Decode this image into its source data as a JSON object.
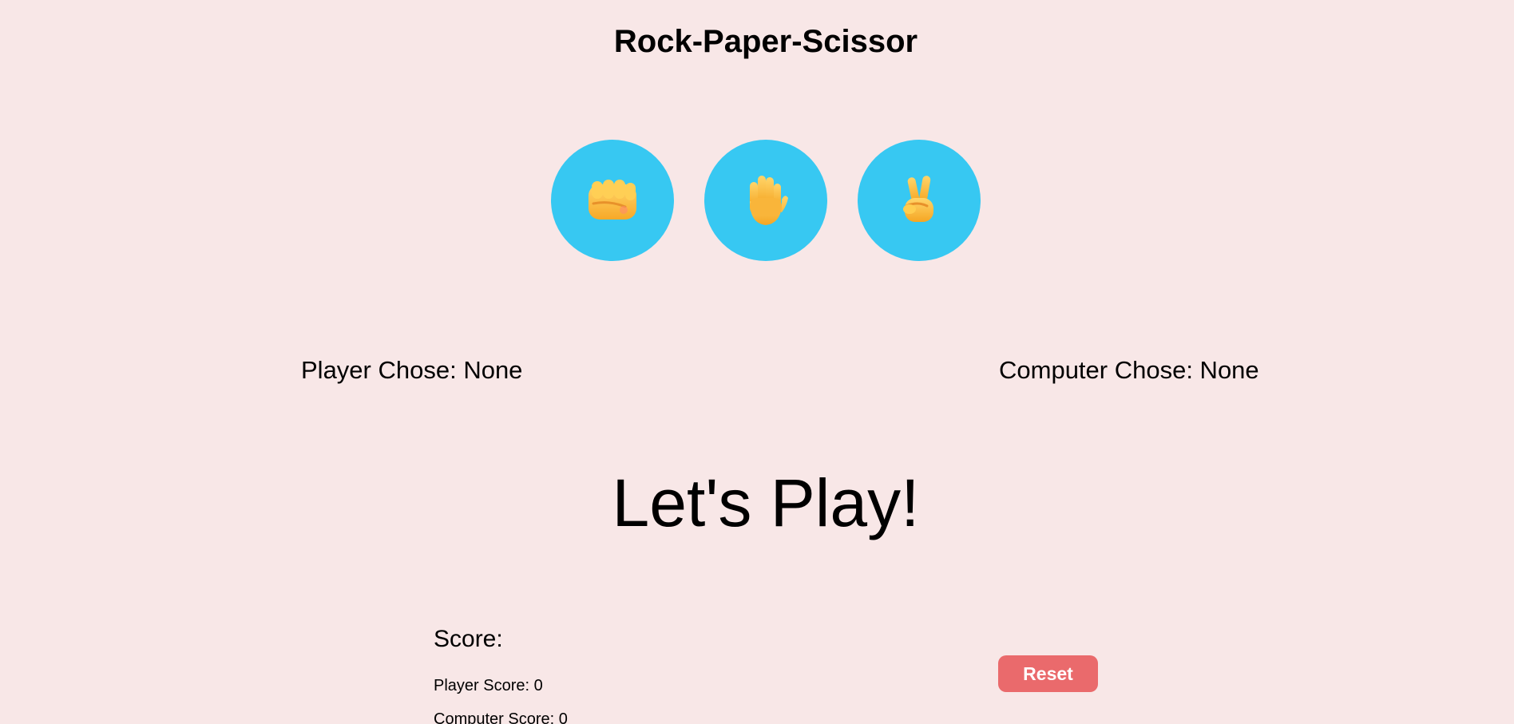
{
  "title": "Rock-Paper-Scissor",
  "choices": [
    {
      "label": "Rock",
      "icon": "fist-icon"
    },
    {
      "label": "Paper",
      "icon": "raised-hand-icon"
    },
    {
      "label": "Scissor",
      "icon": "victory-hand-icon"
    }
  ],
  "player_chose": "Player Chose: None",
  "computer_chose": "Computer Chose: None",
  "status": "Let's Play!",
  "score": {
    "title": "Score:",
    "player": "Player Score: 0",
    "computer": "Computer Score: 0"
  },
  "reset_label": "Reset",
  "colors": {
    "background": "#f8e7e7",
    "choice_button": "#37c8f2",
    "reset_button": "#ea6a6c",
    "emoji_skin": "#ffc83d"
  }
}
